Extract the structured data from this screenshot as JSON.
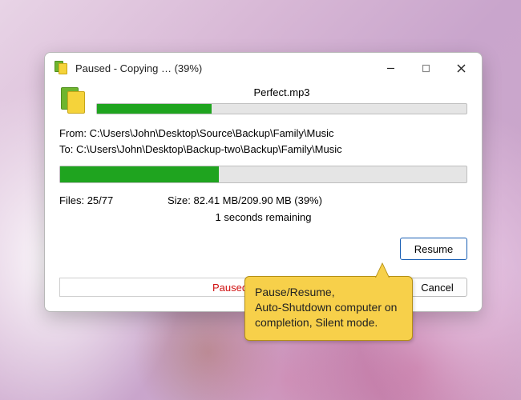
{
  "window": {
    "title": "Paused - Copying … (39%)"
  },
  "file": {
    "current_name": "Perfect.mp3",
    "progress_pct": 31
  },
  "paths": {
    "from_label": "From:",
    "from_value": "C:\\Users\\John\\Desktop\\Source\\Backup\\Family\\Music",
    "to_label": "To:",
    "to_value": "C:\\Users\\John\\Desktop\\Backup-two\\Backup\\Family\\Music"
  },
  "overall": {
    "progress_pct": 39
  },
  "stats": {
    "files_label": "Files:",
    "files_value": "25/77",
    "size_label": "Size:",
    "size_value": "82.41 MB/209.90 MB (39%)",
    "remaining": "1 seconds remaining"
  },
  "buttons": {
    "resume": "Resume",
    "cancel": "Cancel"
  },
  "status": {
    "text": "Paused"
  },
  "callout": {
    "text": "Pause/Resume,\nAuto-Shutdown computer on completion, Silent mode."
  }
}
